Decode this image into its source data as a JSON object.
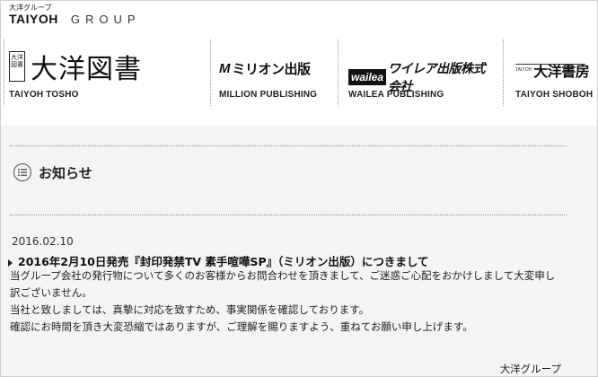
{
  "group": {
    "small_label": "大洋グループ",
    "logo_text": "TAIYOH",
    "group_word": "GROUP"
  },
  "brands": [
    {
      "logo_box": "大洋図書",
      "logo_text": "大洋図書",
      "caption": "TAIYOH TOSHO"
    },
    {
      "logo_mark": "M",
      "logo_text": "ミリオン出版",
      "caption": "MILLION PUBLISHING"
    },
    {
      "logo_badge": "wailea",
      "logo_text": "ワイレア出版株式会社",
      "caption": "WAILEA PUBLISHING"
    },
    {
      "logo_small": "TAIYOH",
      "logo_text": "大洋書房",
      "caption": "TAIYOH SHOBOH"
    }
  ],
  "notice": {
    "title": "お知らせ",
    "date": "2016.02.10",
    "headline": "2016年2月10日発売『封印発禁TV 素手喧嘩SP』（ミリオン出版）につきまして",
    "body": [
      "当グループ会社の発行物について多くのお客様からお問合わせを頂きまして、ご迷惑ご心配をおかけしまして大変申し",
      "訳ございません。",
      "当社と致しましては、真摯に対応を致すため、事実関係を確認しております。",
      "確認にお時間を頂き大変恐縮ではありますが、ご理解を賜りますよう、重ねてお願い申し上げます。"
    ],
    "signature": "大洋グループ"
  },
  "icons": {
    "list": "list-icon"
  }
}
